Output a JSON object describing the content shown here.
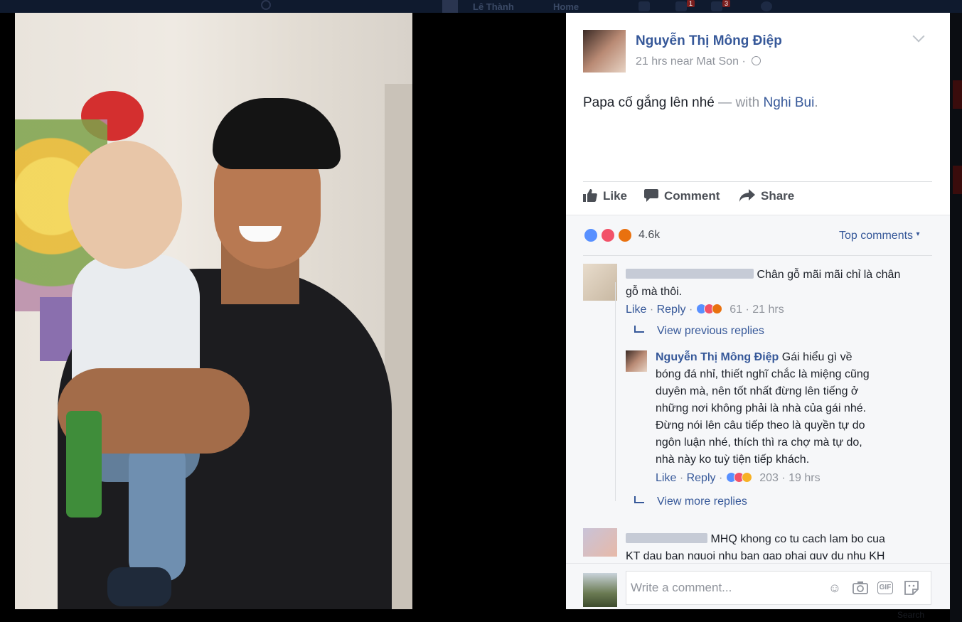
{
  "background": {
    "user_name": "Lê Thành",
    "home_label": "Home",
    "friend_badge": "1",
    "notif_badge": "3",
    "search_label": "Search"
  },
  "post": {
    "author": "Nguyễn Thị Mông Điệp",
    "time": "21 hrs",
    "location": "near Mat Son",
    "separator": "·",
    "text": "Papa cố gắng lên nhé",
    "with_text": "— with",
    "tagged": "Nghi Bui",
    "tag_end": "."
  },
  "actions": {
    "like": "Like",
    "comment": "Comment",
    "share": "Share"
  },
  "reactions": {
    "count": "4.6k",
    "types": [
      "like-icon",
      "love-icon",
      "angry-icon"
    ],
    "sort_label": "Top comments",
    "colors": {
      "like": "#5890ff",
      "love": "#f25268",
      "angry": "#e9710f",
      "haha": "#f7b125"
    }
  },
  "comments": [
    {
      "text_line1": "Chân gỗ mãi mãi chỉ là chân",
      "text_line2": "gỗ mà thôi.",
      "like": "Like",
      "reply": "Reply",
      "reaction_count": "61",
      "time": "21 hrs",
      "view_previous": "View previous replies",
      "reply_item": {
        "author": "Nguyễn Thị Mông Điệp",
        "lines": [
          "Gái hiểu gì về",
          "bóng đá nhỉ, thiết nghĩ chắc là miệng cũng",
          "duyên mà, nên tốt nhất đừng lên tiếng ở",
          "những nơi không phải là nhà của gái nhé.",
          "Đừng nói lên câu tiếp theo là quyền tự do",
          "ngôn luận nhé, thích thì ra chợ mà tự do,",
          "nhà này ko tuỳ tiện tiếp khách."
        ],
        "like": "Like",
        "reply": "Reply",
        "reaction_count": "203",
        "time": "19 hrs"
      },
      "view_more": "View more replies"
    },
    {
      "text_line1": "MHQ khong co tu cach lam bo cua",
      "text_line2": "KT dau ban nguoi nhu ban gap phai quy du nhu KH"
    }
  ],
  "composer": {
    "placeholder": "Write a comment...",
    "icons": [
      "emoji-icon",
      "camera-icon",
      "gif-icon",
      "sticker-icon"
    ],
    "gif_label": "GIF"
  }
}
